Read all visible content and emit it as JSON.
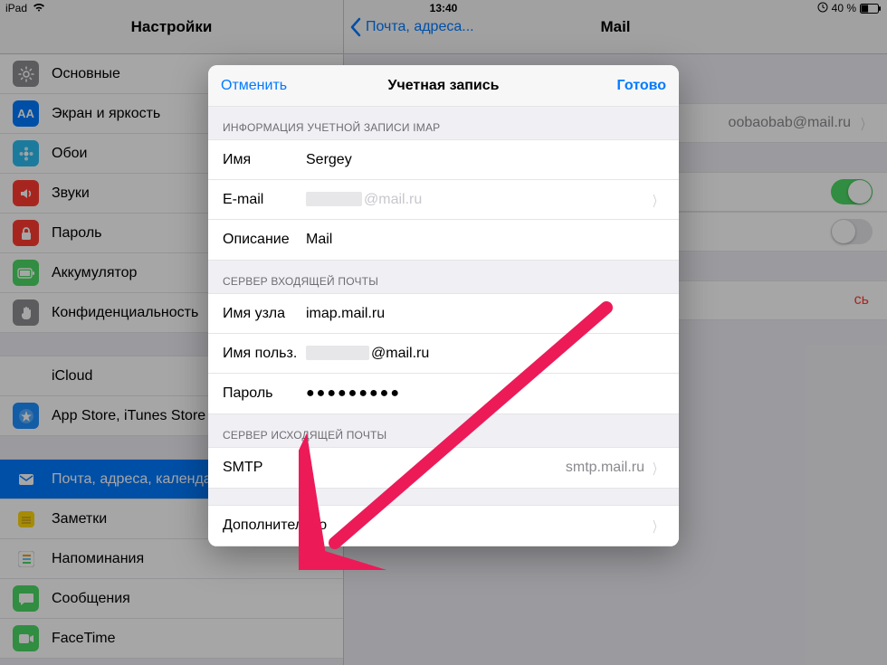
{
  "statusbar": {
    "left": "iPad",
    "wifi": true,
    "time": "13:40",
    "rotation_lock": true,
    "battery_pct": "40 %"
  },
  "sidebar": {
    "title": "Настройки",
    "items": [
      {
        "id": "general",
        "label": "Основные",
        "icon_bg": "#8e8e93",
        "svg": "gear"
      },
      {
        "id": "display",
        "label": "Экран и яркость",
        "icon_bg": "#007aff",
        "svg": "AA"
      },
      {
        "id": "wallpaper",
        "label": "Обои",
        "icon_bg": "#2bbdf0",
        "svg": "flower"
      },
      {
        "id": "sounds",
        "label": "Звуки",
        "icon_bg": "#ff3b30",
        "svg": "speaker"
      },
      {
        "id": "passcode",
        "label": "Пароль",
        "icon_bg": "#ff3b30",
        "svg": "lock"
      },
      {
        "id": "battery",
        "label": "Аккумулятор",
        "icon_bg": "#4cd964",
        "svg": "battery"
      },
      {
        "id": "privacy",
        "label": "Конфиденциальность",
        "icon_bg": "#8e8e93",
        "svg": "hand"
      }
    ],
    "group2": [
      {
        "id": "icloud",
        "label": "iCloud",
        "icon_bg": "#ffffff",
        "svg": "cloud",
        "meta": "blurred"
      },
      {
        "id": "appstore",
        "label": "App Store, iTunes Store",
        "icon_bg": "#1e90ff",
        "svg": "appstore"
      }
    ],
    "group3": [
      {
        "id": "mail",
        "label": "Почта, адреса, календари",
        "icon_bg": "#007aff",
        "svg": "mail",
        "active": true
      },
      {
        "id": "notes",
        "label": "Заметки",
        "icon_bg": "#ffd60a",
        "svg": "notes"
      },
      {
        "id": "reminders",
        "label": "Напоминания",
        "icon_bg": "#ffffff",
        "svg": "reminders"
      },
      {
        "id": "messages",
        "label": "Сообщения",
        "icon_bg": "#4cd964",
        "svg": "bubble"
      },
      {
        "id": "facetime",
        "label": "FaceTime",
        "icon_bg": "#4cd964",
        "svg": "video"
      }
    ]
  },
  "detail": {
    "back_label": "Почта, адреса...",
    "title": "Mail",
    "account_row": {
      "value": "oobaobab@mail.ru"
    },
    "switch1": true,
    "switch2": false,
    "delete_visible_text": "сь"
  },
  "modal": {
    "cancel": "Отменить",
    "title": "Учетная запись",
    "done": "Готово",
    "section1": "ИНФОРМАЦИЯ УЧЕТНОЙ ЗАПИСИ IMAP",
    "name_label": "Имя",
    "name_value": "Sergey",
    "email_label": "E-mail",
    "email_value": "@mail.ru",
    "desc_label": "Описание",
    "desc_value": "Mail",
    "section2": "СЕРВЕР ВХОДЯЩЕЙ ПОЧТЫ",
    "host_label": "Имя узла",
    "host_value": "imap.mail.ru",
    "user_label": "Имя польз.",
    "user_value": "@mail.ru",
    "pass_label": "Пароль",
    "pass_value": "●●●●●●●●●",
    "section3": "СЕРВЕР ИСХОДЯЩЕЙ ПОЧТЫ",
    "smtp_label": "SMTP",
    "smtp_value": "smtp.mail.ru",
    "advanced": "Дополнительно"
  },
  "annotation": {
    "arrow_color": "#ed1a58"
  }
}
